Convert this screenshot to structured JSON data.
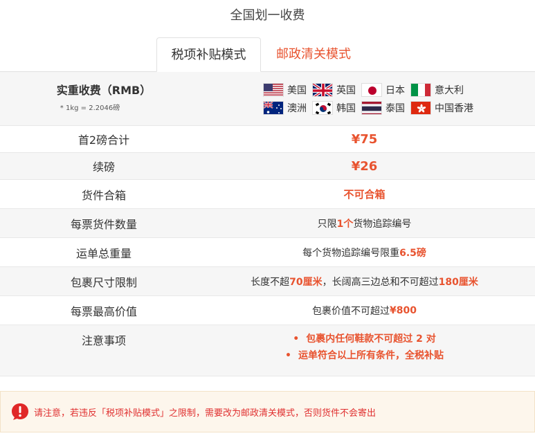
{
  "title": "全国划一收费",
  "tabs": [
    {
      "label": "税项补贴模式",
      "active": true
    },
    {
      "label": "邮政清关模式",
      "active": false
    }
  ],
  "header": {
    "label": "实重收费（RMB）",
    "note": "* 1kg = 2.2046磅",
    "countries_line1": [
      "美国",
      "英国",
      "日本",
      "意大利"
    ],
    "countries_line2": [
      "澳洲",
      "韩国",
      "泰国",
      "中国香港"
    ]
  },
  "rows": [
    {
      "label": "首2磅合计",
      "value": "¥75"
    },
    {
      "label": "续磅",
      "value": "¥26"
    },
    {
      "label": "货件合箱",
      "value": "不可合箱"
    },
    {
      "label": "每票货件数量",
      "pre": "只限 ",
      "hl": "1个",
      "post": " 货物追踪编号"
    },
    {
      "label": "运单总重量",
      "pre": "每个货物追踪编号限重 ",
      "hl": "6.5磅",
      "post": ""
    },
    {
      "label": "包裹尺寸限制",
      "pre": "长度不超 ",
      "hl": "70厘米",
      "mid": "，长阔高三边总和不可超过 ",
      "hl2": "180厘米"
    },
    {
      "label": "每票最高价值",
      "pre": "包裹价值不可超过 ",
      "hl": "¥800",
      "post": ""
    }
  ],
  "notes": {
    "label": "注意事项",
    "items": [
      "包裹内任何鞋款不可超过 2 对",
      "运单符合以上所有条件，全税补贴"
    ]
  },
  "warning": "请注意，若违反「税项补贴模式」之限制，需要改为邮政清关模式，否则货件不会寄出",
  "colors": {
    "accent": "#e8532f",
    "warning_text": "#e03030",
    "warning_bg": "#fdf6ec"
  }
}
